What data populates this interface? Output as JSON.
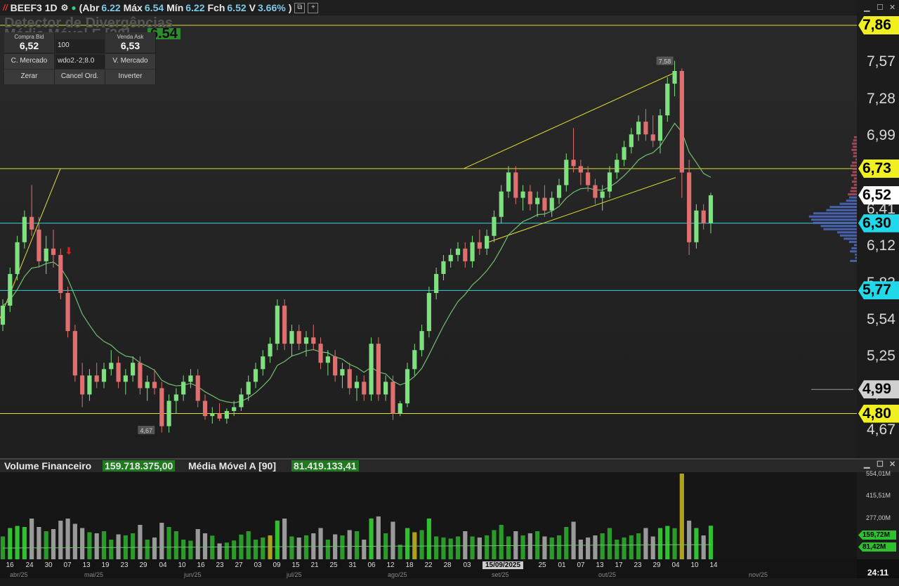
{
  "header": {
    "symbol": "BEEF3",
    "period": "1D",
    "abr_label": "Abr",
    "abr": "6.22",
    "max_label": "Máx",
    "max": "6.54",
    "min_label": "Mín",
    "min": "6.22",
    "fch_label": "Fch",
    "fch": "6.52",
    "v_label": "V",
    "v": "3.66%"
  },
  "overlay": {
    "indicator1": "Detector de Divergências",
    "indicator2": "Média Móvel E [20]",
    "indicator2_value": "6.54"
  },
  "order_panel": {
    "bid_label": "Compra Bid",
    "bid": "6,52",
    "qty": "100",
    "ask_label": "Venda Ask",
    "ask": "6,53",
    "account": "wdo2.-2;8.0",
    "buy_market": "C. Mercado",
    "sell_market": "V. Mercado",
    "zero": "Zerar",
    "cancel": "Cancel Ord.",
    "invert": "Inverter"
  },
  "price_axis": {
    "ticks": [
      "7,57",
      "7,28",
      "6,99",
      "6,41",
      "6,12",
      "5,83",
      "5,54",
      "5,25",
      "4,96",
      "4,67"
    ],
    "tags": [
      {
        "label": "7,86",
        "bg": "#f0f020",
        "fg": "#000000"
      },
      {
        "label": "6,73",
        "bg": "#f0f020",
        "fg": "#000000"
      },
      {
        "label": "6,52",
        "bg": "#ffffff",
        "fg": "#000000"
      },
      {
        "label": "6,30",
        "bg": "#20d8e8",
        "fg": "#000000"
      },
      {
        "label": "5,77",
        "bg": "#20d8e8",
        "fg": "#000000"
      },
      {
        "label": "4,99",
        "bg": "#d0d0d0",
        "fg": "#000000"
      },
      {
        "label": "4,80",
        "bg": "#f0f020",
        "fg": "#000000"
      }
    ]
  },
  "annotations": {
    "high_label": "7,58",
    "low_label": "4,67"
  },
  "volume": {
    "title": "Volume Financeiro",
    "value": "159.718.375,00",
    "ma_title": "Média Móvel A [90]",
    "ma_value": "81.419.133,41",
    "axis": [
      "554,01M",
      "415,51M",
      "277,00M"
    ],
    "tag_current": "159,72M",
    "tag_ma": "81,42M"
  },
  "date_axis": {
    "days": [
      "16",
      "24",
      "30",
      "07",
      "13",
      "19",
      "23",
      "29",
      "04",
      "10",
      "16",
      "23",
      "27",
      "03",
      "09",
      "15",
      "21",
      "25",
      "31",
      "06",
      "12",
      "18",
      "22",
      "28",
      "03",
      "15/09/2025",
      "25",
      "01",
      "07",
      "13",
      "17",
      "23",
      "29",
      "04",
      "10",
      "14"
    ],
    "months": [
      "abr/25",
      "mai/25",
      "jun/25",
      "jul/25",
      "ago/25",
      "set/25",
      "out/25",
      "nov/25"
    ]
  },
  "clock": "24:11",
  "colors": {
    "up": "#7fe07f",
    "down": "#e07070",
    "yellow_line": "#e0e030",
    "cyan_line": "#30d0e0",
    "ma_line": "#6fc06f"
  },
  "chart_data": {
    "type": "candlestick",
    "ylim": [
      4.5,
      7.95
    ],
    "candles": [
      [
        5.5,
        5.7,
        5.45,
        5.65
      ],
      [
        5.65,
        5.95,
        5.6,
        5.9
      ],
      [
        5.9,
        6.2,
        5.85,
        6.15
      ],
      [
        6.15,
        6.4,
        6.1,
        6.35
      ],
      [
        6.35,
        6.6,
        6.2,
        6.25
      ],
      [
        6.25,
        6.35,
        5.95,
        6.0
      ],
      [
        6.0,
        6.2,
        5.9,
        6.1
      ],
      [
        6.1,
        6.25,
        5.95,
        6.05
      ],
      [
        6.05,
        6.1,
        5.7,
        5.75
      ],
      [
        5.75,
        5.8,
        5.4,
        5.45
      ],
      [
        5.45,
        5.5,
        5.05,
        5.1
      ],
      [
        5.1,
        5.2,
        4.85,
        4.95
      ],
      [
        4.95,
        5.15,
        4.9,
        5.1
      ],
      [
        5.1,
        5.2,
        5.0,
        5.05
      ],
      [
        5.05,
        5.2,
        5.0,
        5.15
      ],
      [
        5.15,
        5.3,
        5.1,
        5.2
      ],
      [
        5.2,
        5.25,
        5.0,
        5.05
      ],
      [
        5.05,
        5.15,
        4.95,
        5.1
      ],
      [
        5.1,
        5.25,
        5.05,
        5.2
      ],
      [
        5.2,
        5.25,
        4.95,
        5.0
      ],
      [
        5.0,
        5.1,
        4.9,
        5.05
      ],
      [
        5.05,
        5.15,
        4.95,
        5.0
      ],
      [
        5.0,
        5.05,
        4.65,
        4.7
      ],
      [
        4.7,
        4.95,
        4.65,
        4.9
      ],
      [
        4.9,
        5.0,
        4.8,
        4.95
      ],
      [
        4.95,
        5.1,
        4.9,
        5.05
      ],
      [
        5.05,
        5.15,
        5.0,
        5.1
      ],
      [
        5.1,
        5.15,
        4.85,
        4.9
      ],
      [
        4.9,
        4.95,
        4.75,
        4.78
      ],
      [
        4.78,
        4.85,
        4.72,
        4.8
      ],
      [
        4.8,
        4.88,
        4.74,
        4.76
      ],
      [
        4.76,
        4.84,
        4.72,
        4.82
      ],
      [
        4.82,
        4.9,
        4.78,
        4.85
      ],
      [
        4.85,
        5.0,
        4.82,
        4.95
      ],
      [
        4.95,
        5.1,
        4.9,
        5.05
      ],
      [
        5.05,
        5.2,
        5.0,
        5.15
      ],
      [
        5.15,
        5.3,
        5.1,
        5.25
      ],
      [
        5.25,
        5.4,
        5.2,
        5.35
      ],
      [
        5.35,
        5.7,
        5.3,
        5.65
      ],
      [
        5.65,
        5.7,
        5.3,
        5.35
      ],
      [
        5.35,
        5.5,
        5.25,
        5.45
      ],
      [
        5.45,
        5.5,
        5.3,
        5.35
      ],
      [
        5.35,
        5.45,
        5.25,
        5.4
      ],
      [
        5.4,
        5.5,
        5.3,
        5.35
      ],
      [
        5.35,
        5.4,
        5.15,
        5.2
      ],
      [
        5.2,
        5.3,
        5.1,
        5.25
      ],
      [
        5.25,
        5.3,
        5.05,
        5.1
      ],
      [
        5.1,
        5.2,
        5.0,
        5.15
      ],
      [
        5.15,
        5.2,
        4.95,
        5.0
      ],
      [
        5.0,
        5.1,
        4.9,
        5.05
      ],
      [
        5.05,
        5.1,
        4.9,
        4.95
      ],
      [
        4.95,
        5.4,
        4.9,
        5.35
      ],
      [
        5.35,
        5.4,
        4.9,
        4.95
      ],
      [
        4.95,
        5.1,
        4.9,
        5.05
      ],
      [
        5.05,
        5.1,
        4.75,
        4.8
      ],
      [
        4.8,
        4.9,
        4.78,
        4.88
      ],
      [
        4.88,
        5.2,
        4.85,
        5.15
      ],
      [
        5.15,
        5.35,
        5.1,
        5.3
      ],
      [
        5.3,
        5.5,
        5.25,
        5.45
      ],
      [
        5.45,
        5.8,
        5.4,
        5.75
      ],
      [
        5.75,
        5.95,
        5.7,
        5.9
      ],
      [
        5.9,
        6.05,
        5.85,
        6.0
      ],
      [
        6.0,
        6.1,
        5.95,
        6.05
      ],
      [
        6.05,
        6.15,
        6.0,
        6.1
      ],
      [
        6.1,
        6.15,
        5.95,
        6.0
      ],
      [
        6.0,
        6.2,
        5.95,
        6.15
      ],
      [
        6.15,
        6.25,
        6.05,
        6.1
      ],
      [
        6.1,
        6.25,
        6.05,
        6.2
      ],
      [
        6.2,
        6.4,
        6.15,
        6.35
      ],
      [
        6.35,
        6.6,
        6.3,
        6.55
      ],
      [
        6.55,
        6.75,
        6.5,
        6.7
      ],
      [
        6.7,
        6.75,
        6.45,
        6.5
      ],
      [
        6.5,
        6.6,
        6.4,
        6.55
      ],
      [
        6.55,
        6.6,
        6.4,
        6.45
      ],
      [
        6.45,
        6.55,
        6.35,
        6.5
      ],
      [
        6.5,
        6.6,
        6.35,
        6.4
      ],
      [
        6.4,
        6.55,
        6.35,
        6.5
      ],
      [
        6.5,
        6.65,
        6.45,
        6.6
      ],
      [
        6.6,
        6.85,
        6.55,
        6.8
      ],
      [
        6.8,
        7.05,
        6.7,
        6.75
      ],
      [
        6.75,
        6.8,
        6.6,
        6.7
      ],
      [
        6.7,
        6.75,
        6.55,
        6.6
      ],
      [
        6.6,
        6.65,
        6.45,
        6.5
      ],
      [
        6.5,
        6.6,
        6.4,
        6.55
      ],
      [
        6.55,
        6.75,
        6.5,
        6.7
      ],
      [
        6.7,
        6.85,
        6.65,
        6.8
      ],
      [
        6.8,
        6.95,
        6.75,
        6.9
      ],
      [
        6.9,
        7.05,
        6.85,
        7.0
      ],
      [
        7.0,
        7.15,
        6.95,
        7.1
      ],
      [
        7.1,
        7.2,
        6.95,
        7.0
      ],
      [
        7.0,
        7.15,
        6.9,
        6.95
      ],
      [
        6.95,
        7.2,
        6.85,
        7.15
      ],
      [
        7.15,
        7.45,
        7.1,
        7.4
      ],
      [
        7.4,
        7.58,
        7.3,
        7.5
      ],
      [
        7.5,
        7.52,
        6.5,
        6.7
      ],
      [
        6.7,
        6.8,
        6.05,
        6.15
      ],
      [
        6.15,
        6.45,
        6.1,
        6.4
      ],
      [
        6.4,
        6.45,
        6.25,
        6.3
      ],
      [
        6.3,
        6.54,
        6.22,
        6.52
      ]
    ]
  }
}
